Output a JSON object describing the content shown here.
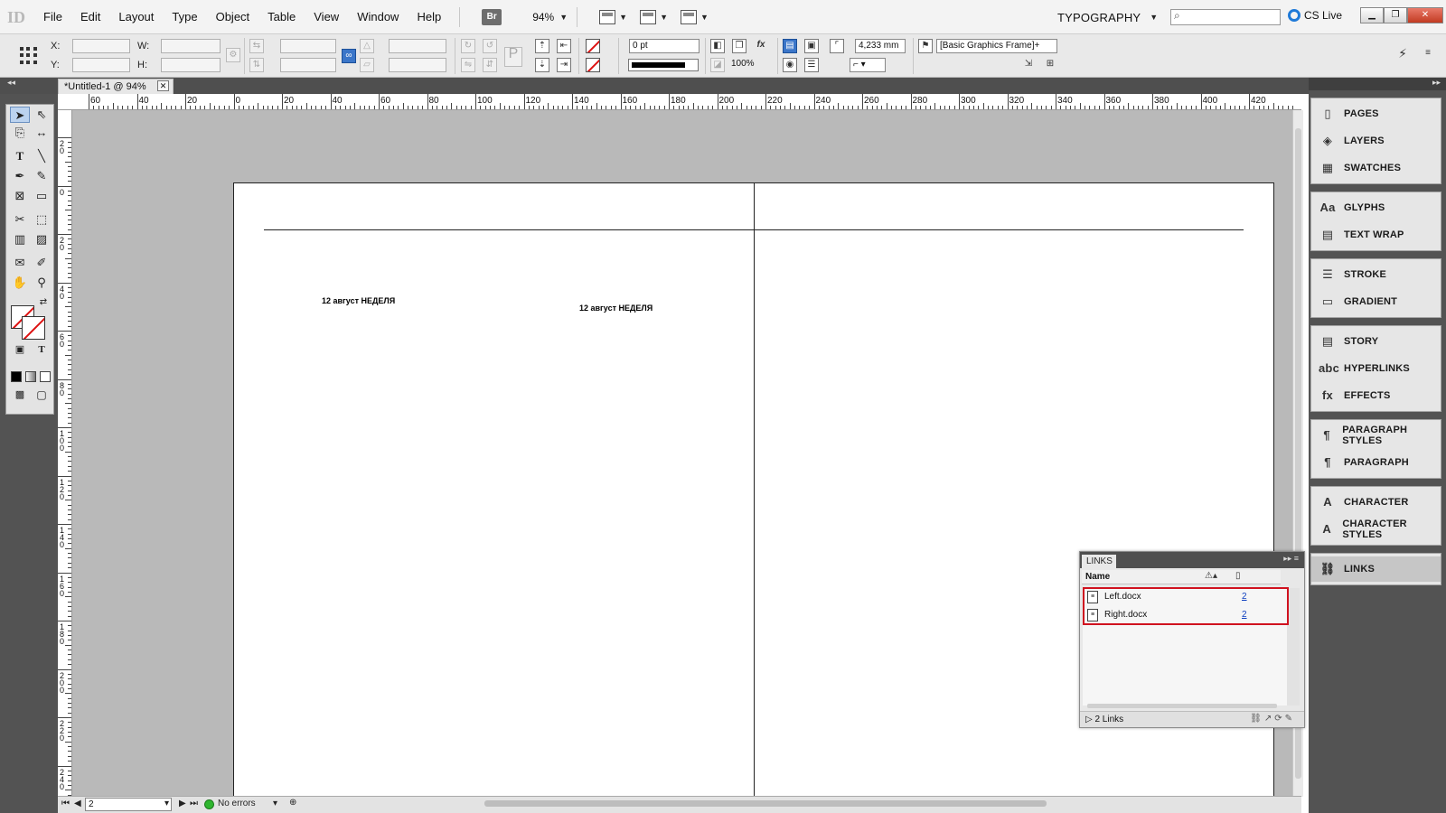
{
  "app": {
    "logo": "ID",
    "menu": [
      "File",
      "Edit",
      "Layout",
      "Type",
      "Object",
      "Table",
      "View",
      "Window",
      "Help"
    ],
    "bridge_label": "Br",
    "zoom": "94%",
    "workspace": "TYPOGRAPHY",
    "search_placeholder": "",
    "cs_live": "CS Live"
  },
  "control_panel": {
    "x_label": "X:",
    "y_label": "Y:",
    "w_label": "W:",
    "h_label": "H:",
    "stroke_weight": "0 pt",
    "opacity": "100%",
    "offset": "4,233 mm",
    "object_style": "[Basic Graphics Frame]+"
  },
  "document": {
    "tab_title": "*Untitled-1 @ 94%",
    "ruler_h_labels": [
      "60",
      "40",
      "20",
      "0",
      "20",
      "40",
      "60",
      "80",
      "100",
      "120",
      "140",
      "160",
      "180",
      "200",
      "220",
      "240",
      "260",
      "280",
      "300",
      "320",
      "340",
      "360",
      "380",
      "400",
      "420"
    ],
    "ruler_v_labels": [
      "20",
      "0",
      "20",
      "40",
      "60",
      "80",
      "100",
      "120",
      "140",
      "160",
      "180",
      "200",
      "220",
      "240"
    ],
    "left_text": "12 август НЕДЕЛЯ",
    "right_text": "12 август НЕДЕЛЯ"
  },
  "status": {
    "page": "2",
    "preflight": "No errors"
  },
  "panels": {
    "groups": [
      [
        {
          "label": "PAGES",
          "icon": "pages-icon"
        },
        {
          "label": "LAYERS",
          "icon": "layers-icon"
        },
        {
          "label": "SWATCHES",
          "icon": "swatches-icon"
        }
      ],
      [
        {
          "label": "GLYPHS",
          "icon": "glyphs-icon"
        },
        {
          "label": "TEXT WRAP",
          "icon": "text-wrap-icon"
        }
      ],
      [
        {
          "label": "STROKE",
          "icon": "stroke-icon"
        },
        {
          "label": "GRADIENT",
          "icon": "gradient-icon"
        }
      ],
      [
        {
          "label": "STORY",
          "icon": "story-icon"
        },
        {
          "label": "HYPERLINKS",
          "icon": "hyperlinks-icon"
        },
        {
          "label": "EFFECTS",
          "icon": "effects-icon"
        }
      ],
      [
        {
          "label": "PARAGRAPH STYLES",
          "icon": "paragraph-styles-icon"
        },
        {
          "label": "PARAGRAPH",
          "icon": "paragraph-icon"
        }
      ],
      [
        {
          "label": "CHARACTER",
          "icon": "character-icon"
        },
        {
          "label": "CHARACTER STYLES",
          "icon": "character-styles-icon"
        }
      ],
      [
        {
          "label": "LINKS",
          "icon": "links-icon"
        }
      ]
    ]
  },
  "links_panel": {
    "tab": "LINKS",
    "column_name": "Name",
    "rows": [
      {
        "name": "Left.docx",
        "page": "2"
      },
      {
        "name": "Right.docx",
        "page": "2"
      }
    ],
    "count": "2 Links",
    "highlight_color": "#d0121f"
  }
}
